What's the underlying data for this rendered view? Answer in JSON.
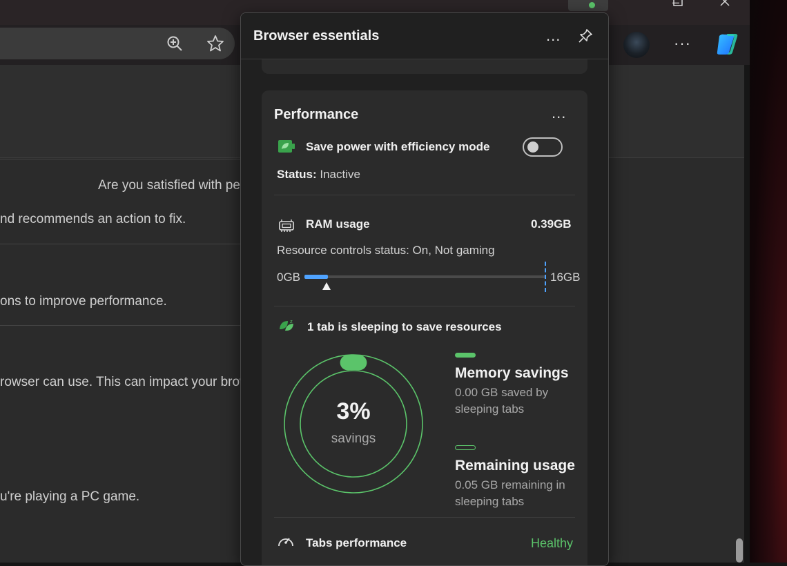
{
  "background_page": {
    "line1": "Are you satisfied with pe",
    "line2": "nd recommends an action to fix.",
    "line3": "ons to improve performance.",
    "line4": "rowser can use. This can impact your brow",
    "line5": "u're playing a PC game."
  },
  "panel": {
    "title": "Browser essentials",
    "more_label": "...",
    "pin_icon": "pin-icon"
  },
  "performance": {
    "title": "Performance",
    "more_label": "...",
    "efficiency": {
      "icon": "leaf-battery-icon",
      "label": "Save power with efficiency mode",
      "toggle_on": false,
      "status_label": "Status:",
      "status_value": "Inactive"
    },
    "ram": {
      "icon": "memory-chip-icon",
      "label": "RAM usage",
      "value": "0.39GB",
      "resource_controls": "Resource controls status: On, Not gaming",
      "min_label": "0GB",
      "max_label": "16GB",
      "used_fraction": 0.024
    },
    "sleeping": {
      "icon": "sleeping-tabs-icon",
      "label": "1 tab is sleeping to save resources",
      "percent": "3%",
      "percent_label": "savings",
      "savings_fraction": 0.03,
      "memory_savings_title": "Memory savings",
      "memory_savings_desc": "0.00 GB saved by sleeping tabs",
      "remaining_title": "Remaining usage",
      "remaining_desc": "0.05 GB remaining in sleeping tabs"
    },
    "tabs_perf": {
      "icon": "speedometer-icon",
      "label": "Tabs performance",
      "status": "Healthy"
    }
  },
  "colors": {
    "accent_green": "#5bc46a",
    "accent_blue": "#4fa3ff",
    "panel_bg": "#202020",
    "card_bg": "#2b2b2b"
  }
}
